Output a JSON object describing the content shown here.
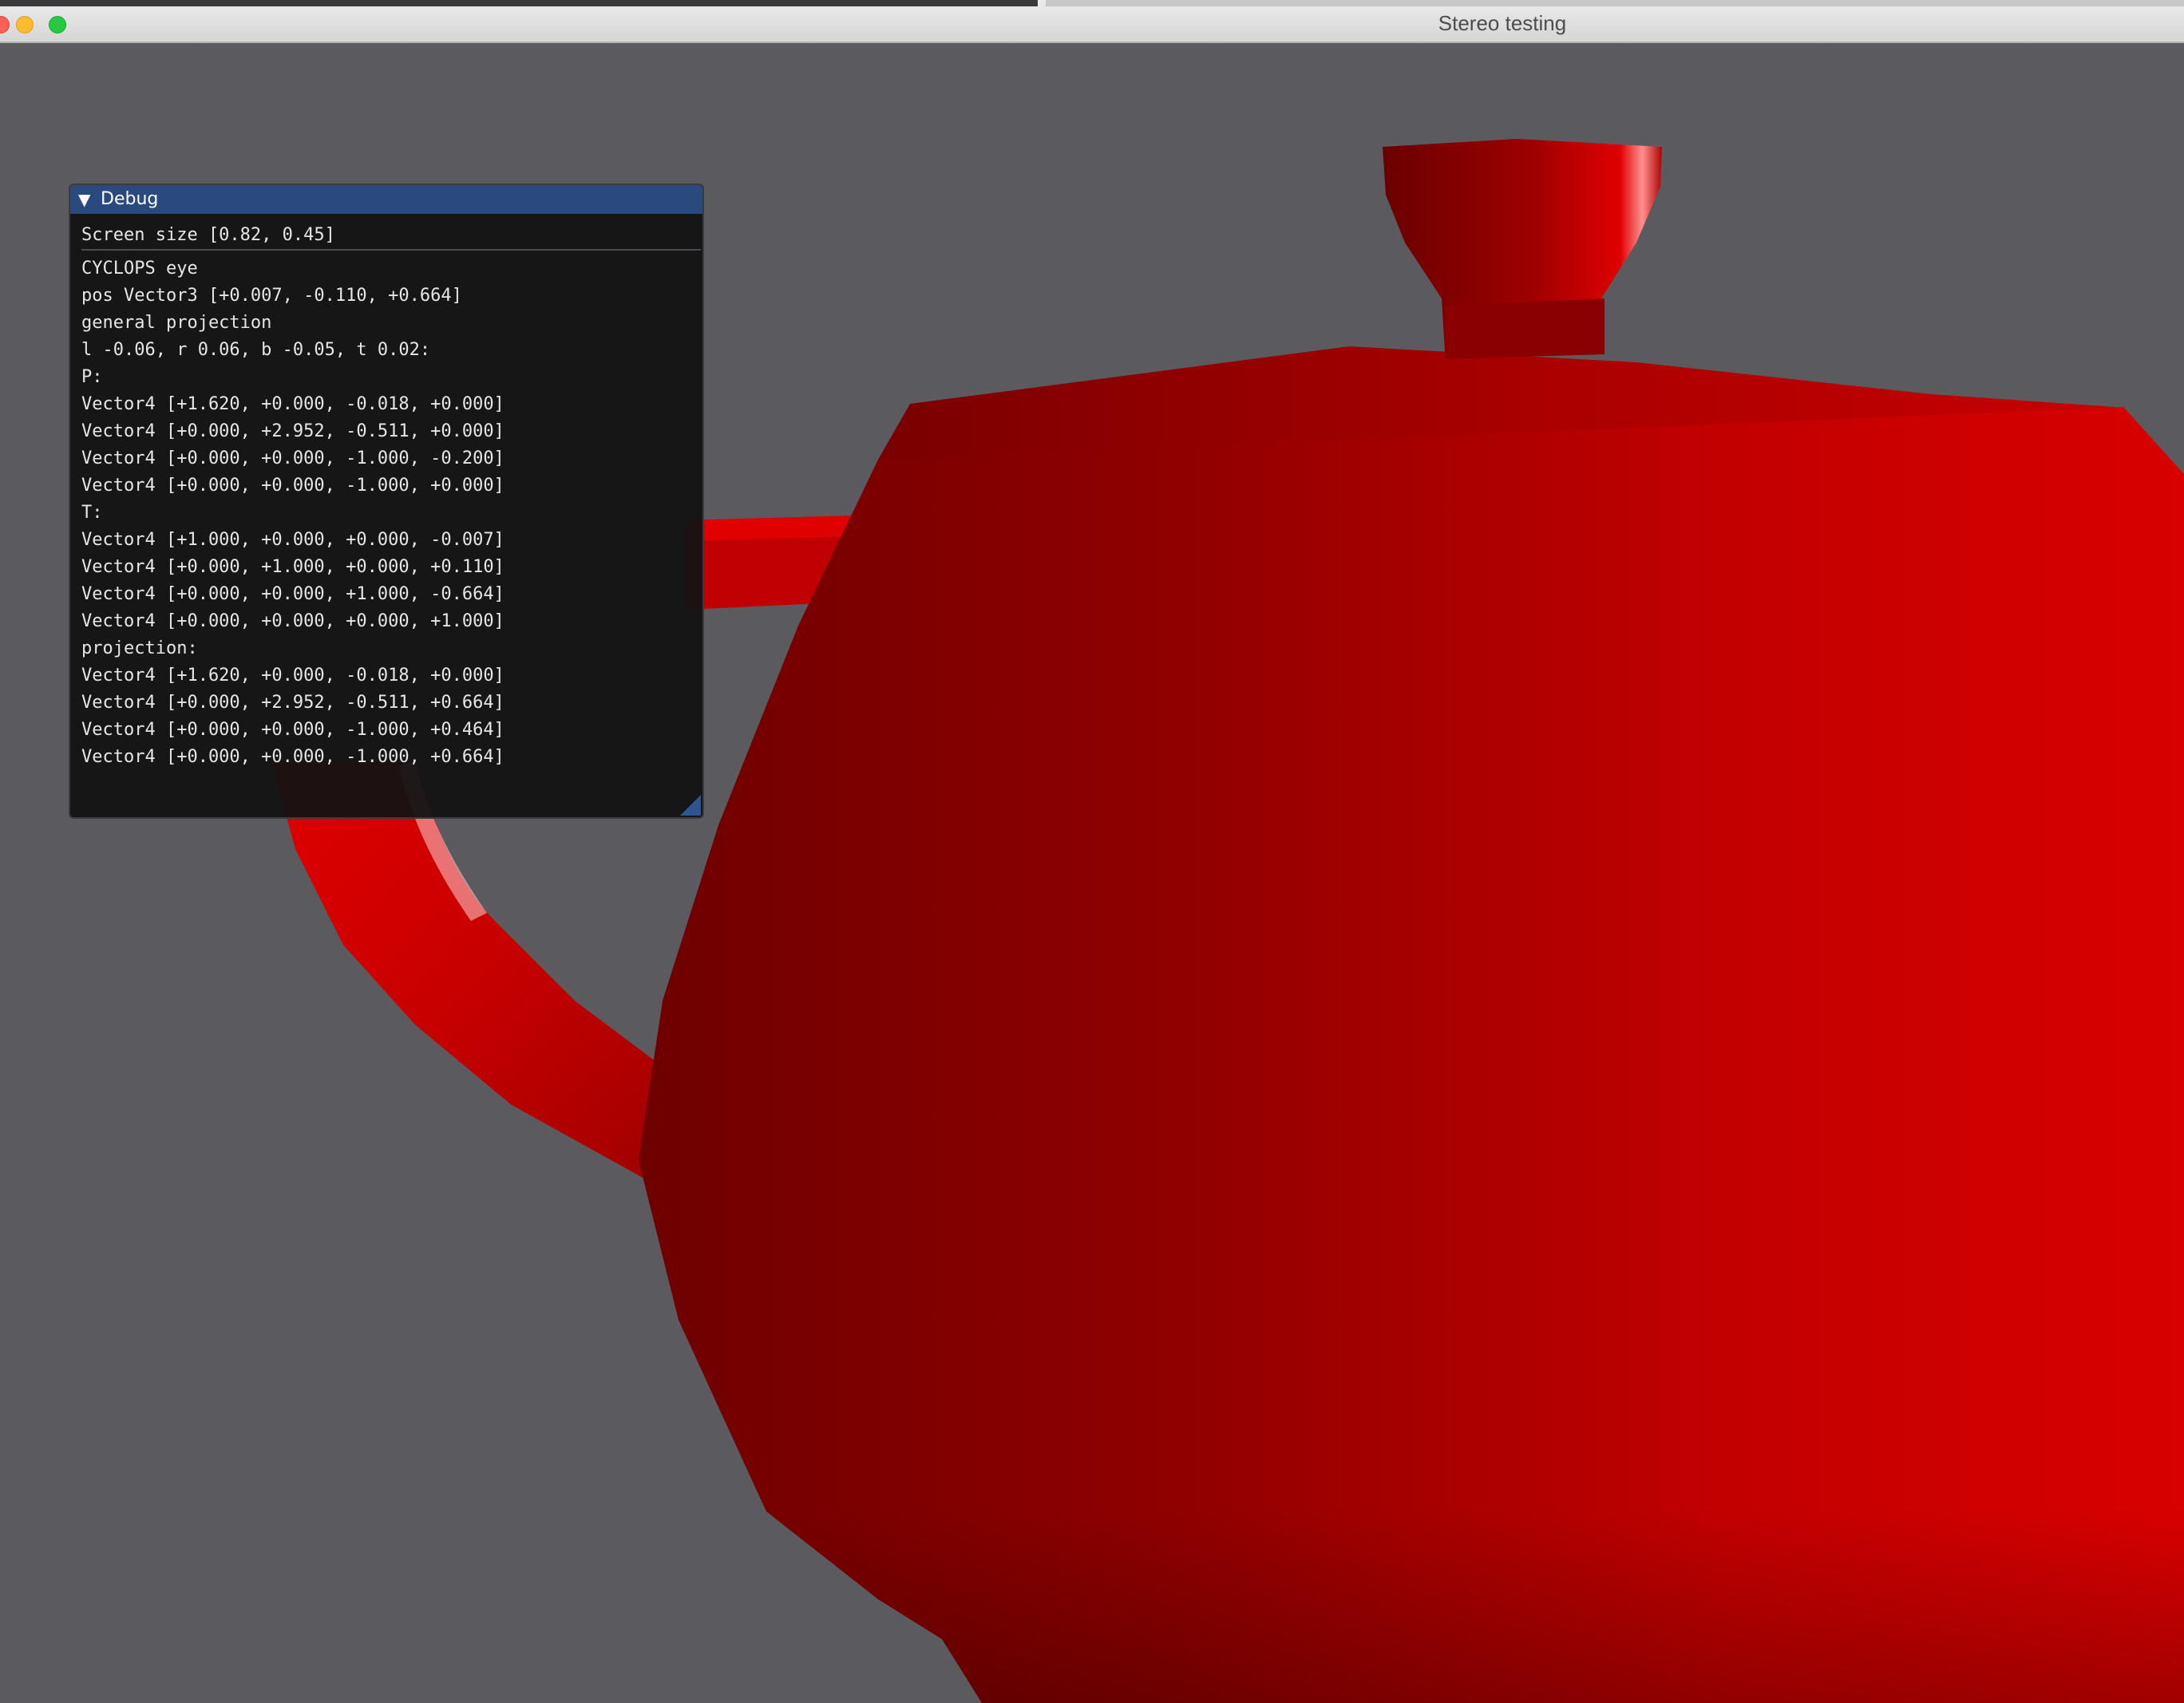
{
  "window": {
    "title": "Stereo testing"
  },
  "colors": {
    "background": "#5b5b5f",
    "teapot": "#d40000",
    "teapot_dark": "#7a0000",
    "panel_header": "#2a4a7f",
    "panel_bg": "#121212"
  },
  "debug_panel": {
    "title": "Debug",
    "collapse_icon": "▼",
    "screen_size": "Screen size [0.82, 0.45]",
    "lines": [
      "CYCLOPS eye",
      "pos Vector3 [+0.007, -0.110, +0.664]",
      "general projection",
      "l -0.06, r 0.06, b -0.05, t 0.02:",
      "P:",
      "Vector4 [+1.620, +0.000, -0.018, +0.000]",
      "Vector4 [+0.000, +2.952, -0.511, +0.000]",
      "Vector4 [+0.000, +0.000, -1.000, -0.200]",
      "Vector4 [+0.000, +0.000, -1.000, +0.000]",
      "T:",
      "Vector4 [+1.000, +0.000, +0.000, -0.007]",
      "Vector4 [+0.000, +1.000, +0.000, +0.110]",
      "Vector4 [+0.000, +0.000, +1.000, -0.664]",
      "Vector4 [+0.000, +0.000, +0.000, +1.000]",
      "projection:",
      "Vector4 [+1.620, +0.000, -0.018, +0.000]",
      "Vector4 [+0.000, +2.952, -0.511, +0.664]",
      "Vector4 [+0.000, +0.000, -1.000, +0.464]",
      "Vector4 [+0.000, +0.000, -1.000, +0.664]"
    ]
  }
}
